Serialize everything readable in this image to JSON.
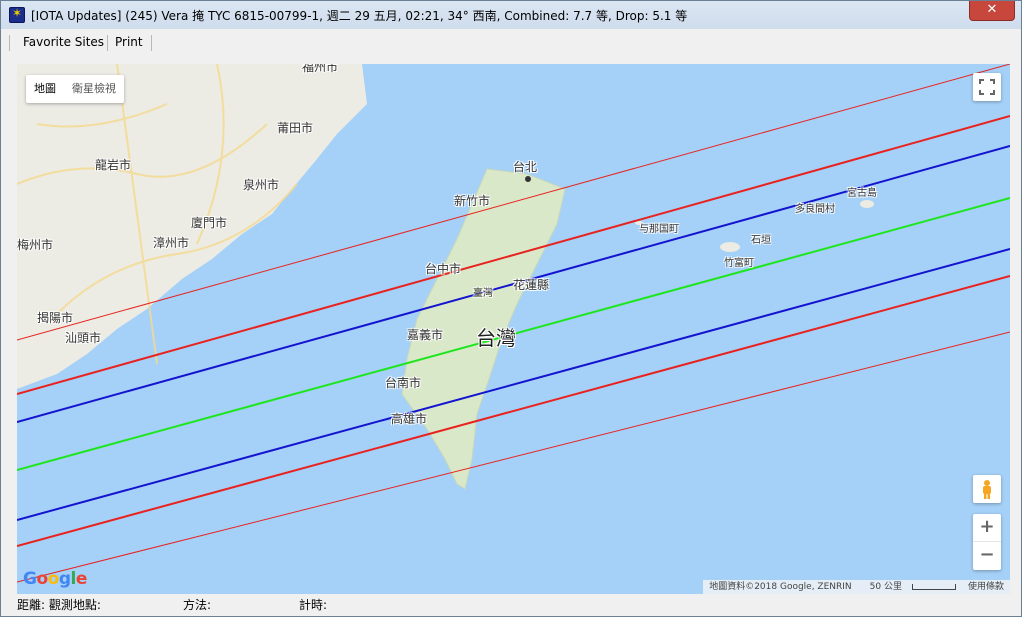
{
  "window": {
    "title": "[IOTA Updates] (245) Vera 掩 TYC 6815-00799-1, 週二 29 五月, 02:21, 34° 西南, Combined:  7.7 等, Drop:  5.1 等",
    "close_label": "✕"
  },
  "menu": {
    "items": [
      {
        "label": "Favorite Sites"
      },
      {
        "label": "Print"
      }
    ]
  },
  "map": {
    "map_type_map": "地圖",
    "map_type_satellite": "衛星檢視",
    "zoom_in": "+",
    "zoom_out": "−",
    "google": "Google",
    "attribution": "地圖資料©2018 Google, ZENRIN",
    "scale": "50 公里",
    "terms": "使用條款",
    "places": {
      "taipei": "台北",
      "hsinchu": "新竹市",
      "taichung": "台中市",
      "nantou": "臺灣",
      "hualien": "花蓮縣",
      "chiayi": "嘉義市",
      "taiwan": "台灣",
      "tainan": "台南市",
      "kaohsiung": "高雄市",
      "putian": "莆田市",
      "longyan": "龍岩市",
      "quanzhou": "泉州市",
      "xiamen": "廈門市",
      "zhangzhou": "漳州市",
      "meizhou": "梅州市",
      "jieyang": "揭陽市",
      "shantou": "汕頭市",
      "fuzhou": "福州市",
      "yonaguni": "与那国町",
      "tarama": "多良間村",
      "miyako": "宮古島",
      "ishigaki": "石垣",
      "taketomi": "竹富町"
    },
    "colors": {
      "water": "#a5d0f7",
      "land": "#ecebe4",
      "island": "#d9e8c9",
      "limit_outer": "#e8231f",
      "limit_inner": "#1414d0",
      "centerline": "#1ee61e"
    }
  },
  "status": {
    "distance_label": "距離: 觀測地點:",
    "method_label": "方法:",
    "timing_label": "計時:"
  }
}
